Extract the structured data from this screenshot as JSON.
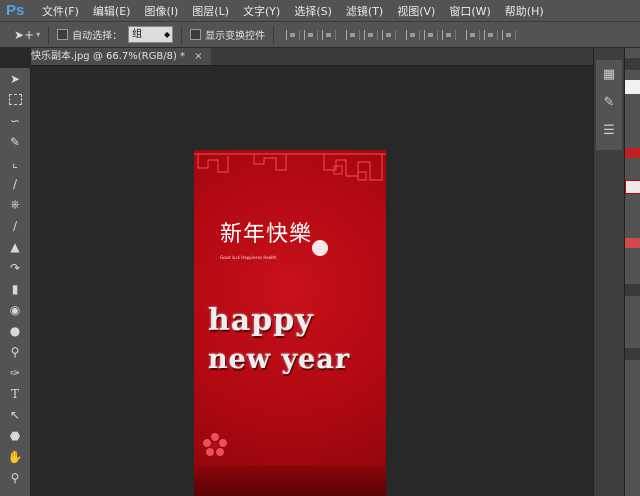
{
  "app": {
    "logo": "Ps"
  },
  "menu": [
    "文件(F)",
    "编辑(E)",
    "图像(I)",
    "图层(L)",
    "文字(Y)",
    "选择(S)",
    "滤镜(T)",
    "视图(V)",
    "窗口(W)",
    "帮助(H)"
  ],
  "options": {
    "tool_icon": "move-tool-icon",
    "auto_select_label": "自动选择：",
    "auto_select_value": "组",
    "show_transform_label": "显示变换控件"
  },
  "document": {
    "tab_title": "快乐副本.jpg @ 66.7%(RGB/8) *",
    "close": "×"
  },
  "artwork": {
    "cn_title": "新年快樂",
    "subtitle": "Good luck Happiness Health",
    "line1": "happy",
    "line2": "new year"
  },
  "colors": {
    "chrome": "#535353",
    "canvas_bg": "#282828",
    "art_red": "#c8101a",
    "ps_blue": "#56a2e0"
  }
}
